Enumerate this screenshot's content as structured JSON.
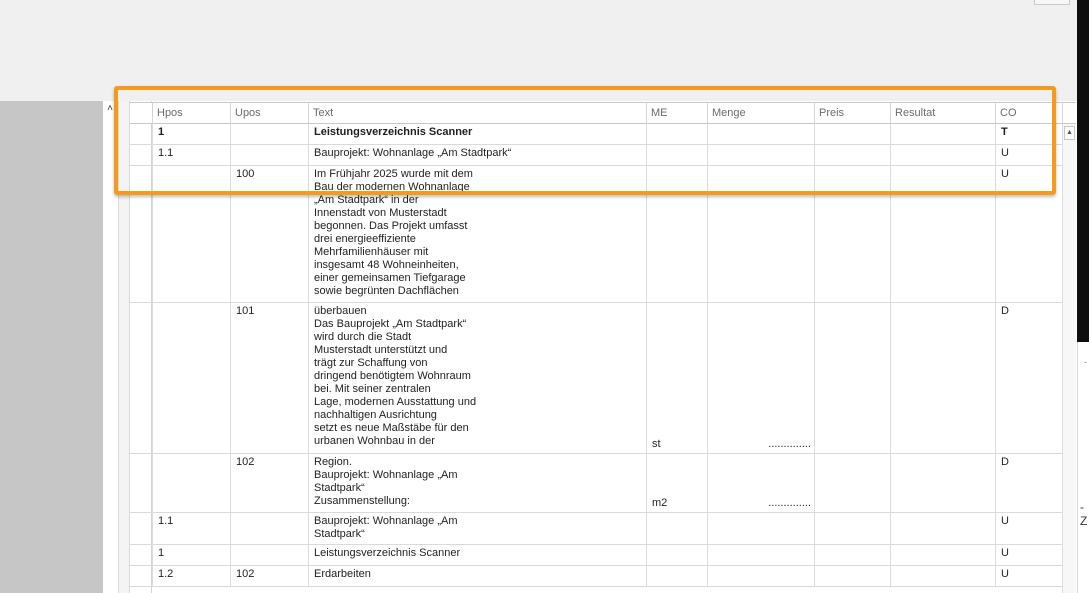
{
  "columns": {
    "hpos": "Hpos",
    "upos": "Upos",
    "text": "Text",
    "me": "ME",
    "menge": "Menge",
    "preis": "Preis",
    "resultat": "Resultat",
    "co": "CO"
  },
  "rows": [
    {
      "hpos": "1",
      "upos": "",
      "text": [
        "Leistungsverzeichnis Scanner"
      ],
      "me": "",
      "menge": "",
      "co": "T",
      "bold": true
    },
    {
      "hpos": "1.1",
      "upos": "",
      "text": [
        "Bauprojekt: Wohnanlage „Am Stadtpark“"
      ],
      "me": "",
      "menge": "",
      "co": "U"
    },
    {
      "hpos": "",
      "upos": "100",
      "text": [
        "Im Frühjahr 2025 wurde mit dem",
        "Bau der modernen Wohnanlage",
        "„Am Stadtpark“ in der",
        "Innenstadt von Musterstadt",
        "begonnen. Das Projekt umfasst",
        "drei energieeffiziente",
        "Mehrfamilienhäuser mit",
        "insgesamt 48 Wohneinheiten,",
        "einer gemeinsamen Tiefgarage",
        "sowie begrünten Dachflächen"
      ],
      "me": "",
      "menge": "",
      "co": "U"
    },
    {
      "hpos": "",
      "upos": "101",
      "text": [
        "überbauen",
        "Das Bauprojekt „Am Stadtpark“",
        "wird durch die Stadt",
        "Musterstadt unterstützt und",
        "trägt zur Schaffung von",
        "dringend benötigtem Wohnraum",
        "bei. Mit seiner zentralen",
        "Lage, modernen Ausstattung und",
        "nachhaltigen Ausrichtung",
        "setzt es neue Maßstäbe für den",
        "urbanen Wohnbau in der"
      ],
      "me": "st",
      "menge": "..............",
      "co": "D"
    },
    {
      "hpos": "",
      "upos": "102",
      "text": [
        "Region.",
        "Bauprojekt: Wohnanlage „Am",
        "Stadtpark“",
        "Zusammenstellung:"
      ],
      "me": "m2",
      "menge": "..............",
      "co": "D"
    },
    {
      "hpos": "1.1",
      "upos": "",
      "text": [
        "Bauprojekt: Wohnanlage „Am",
        "Stadtpark“"
      ],
      "me": "",
      "menge": "",
      "co": "U"
    },
    {
      "hpos": "1",
      "upos": "",
      "text": [
        "Leistungsverzeichnis Scanner"
      ],
      "me": "",
      "menge": "",
      "co": "U"
    },
    {
      "hpos": "1.2",
      "upos": "102",
      "text": [
        "Erdarbeiten"
      ],
      "me": "",
      "menge": "",
      "co": "U"
    }
  ],
  "icons": {
    "collapse": "chevron-up-icon",
    "scroll_up": "scroll-up-arrow-icon"
  },
  "colors": {
    "highlight": "#f39a1f",
    "left_pane": "#c6c6c6"
  },
  "side_marks": {
    "right_tick": "-",
    "right_z": "-Z"
  }
}
